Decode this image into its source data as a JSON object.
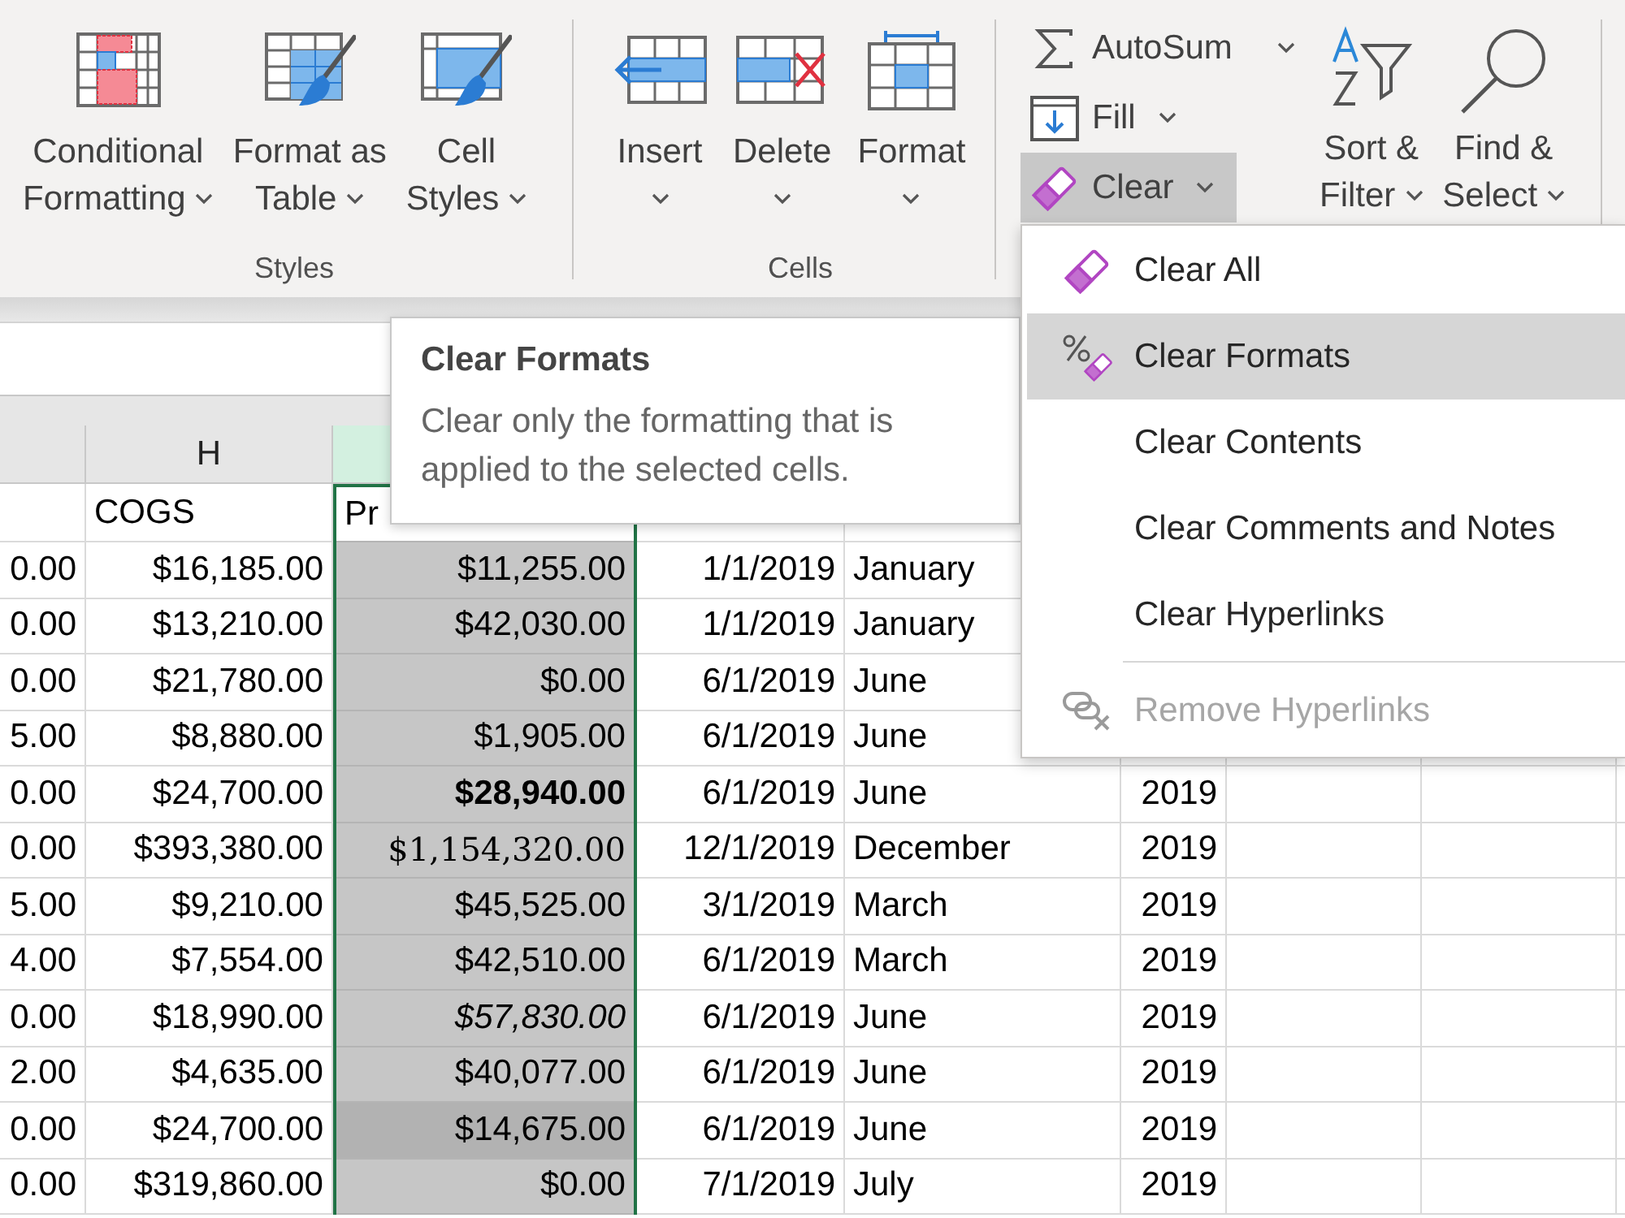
{
  "ribbon": {
    "groups": [
      {
        "label": "Styles",
        "buttons": [
          {
            "kind": "large",
            "lines": [
              "Conditional",
              "Formatting"
            ],
            "dropdown": true,
            "pressed": false
          },
          {
            "kind": "large",
            "lines": [
              "Format as",
              "Table"
            ],
            "dropdown": true,
            "pressed": false
          },
          {
            "kind": "large",
            "lines": [
              "Cell",
              "Styles"
            ],
            "dropdown": true,
            "pressed": false
          }
        ]
      },
      {
        "label": "Cells",
        "buttons": [
          {
            "kind": "large",
            "lines": [
              "Insert"
            ],
            "dropdown": true,
            "pressed": false
          },
          {
            "kind": "large",
            "lines": [
              "Delete"
            ],
            "dropdown": true,
            "pressed": false
          },
          {
            "kind": "large",
            "lines": [
              "Format"
            ],
            "dropdown": true,
            "pressed": false
          }
        ]
      },
      {
        "buttons": [
          {
            "kind": "small",
            "lines": [
              "AutoSum"
            ],
            "dropdown": true,
            "pressed": false
          },
          {
            "kind": "small",
            "lines": [
              "Fill"
            ],
            "dropdown": true,
            "pressed": false
          },
          {
            "kind": "small",
            "lines": [
              "Clear"
            ],
            "dropdown": true,
            "pressed": true
          },
          {
            "kind": "large",
            "lines": [
              "Sort &",
              "Filter"
            ],
            "dropdown": true,
            "pressed": false
          },
          {
            "kind": "large",
            "lines": [
              "Find &",
              "Select"
            ],
            "dropdown": true,
            "pressed": false
          }
        ]
      }
    ]
  },
  "menu": {
    "items": [
      {
        "label": "Clear All",
        "selected": false,
        "disabled": false,
        "divider_before": false
      },
      {
        "label": "Clear Formats",
        "selected": true,
        "disabled": false,
        "divider_before": false
      },
      {
        "label": "Clear Contents",
        "selected": false,
        "disabled": false,
        "divider_before": false
      },
      {
        "label": "Clear Comments and Notes",
        "selected": false,
        "disabled": false,
        "divider_before": false
      },
      {
        "label": "Clear Hyperlinks",
        "selected": false,
        "disabled": false,
        "divider_before": false
      },
      {
        "label": "Remove Hyperlinks",
        "selected": false,
        "disabled": true,
        "divider_before": true
      }
    ]
  },
  "tooltip": {
    "title": "Clear Formats",
    "text": "Clear only the formatting that is applied to the selected cells."
  },
  "sheet": {
    "columns": [
      {
        "selected": false,
        "cells": [
          null,
          "0.00",
          "0.00",
          "0.00",
          "5.00",
          "0.00",
          "0.00",
          "5.00",
          "4.00",
          "0.00",
          "2.00",
          "0.00",
          "0.00"
        ]
      },
      {
        "label": "H",
        "selected": false,
        "cells": [
          "COGS",
          "$16,185.00",
          "$13,210.00",
          "$21,780.00",
          "$8,880.00",
          "$24,700.00",
          "$393,380.00",
          "$9,210.00",
          "$7,554.00",
          "$18,990.00",
          "$4,635.00",
          "$24,700.00",
          "$319,860.00"
        ]
      },
      {
        "selected": true,
        "cells": [
          {
            "text": "Pr",
            "active": true,
            "kind": "plain"
          },
          {
            "text": "$11,255.00",
            "active": false,
            "kind": "plain"
          },
          {
            "text": "$42,030.00",
            "active": false,
            "kind": "plain"
          },
          {
            "text": "$0.00",
            "active": false,
            "kind": "plain"
          },
          {
            "text": "$1,905.00",
            "active": false,
            "kind": "plain"
          },
          {
            "text": "$28,940.00",
            "active": false,
            "kind": "bold"
          },
          {
            "text": "$1,154,320.00",
            "active": false,
            "kind": "serif"
          },
          {
            "text": "$45,525.00",
            "active": false,
            "kind": "plain"
          },
          {
            "text": "$42,510.00",
            "active": false,
            "kind": "plain"
          },
          {
            "text": "$57,830.00",
            "active": false,
            "kind": "italic"
          },
          {
            "text": "$40,077.00",
            "active": false,
            "kind": "plain"
          },
          {
            "text": "$14,675.00",
            "active": false,
            "kind": "shaded"
          },
          {
            "text": "$0.00",
            "active": false,
            "kind": "plain"
          }
        ]
      },
      {
        "selected": false,
        "cells": [
          null,
          "1/1/2019",
          "1/1/2019",
          "6/1/2019",
          "6/1/2019",
          "6/1/2019",
          "12/1/2019",
          "3/1/2019",
          "6/1/2019",
          "6/1/2019",
          "6/1/2019",
          "6/1/2019",
          "7/1/2019"
        ]
      },
      {
        "selected": false,
        "cells": [
          null,
          "January",
          "January",
          "June",
          "June",
          "June",
          "December",
          "March",
          "March",
          "June",
          "June",
          "June",
          "July"
        ]
      },
      {
        "selected": false,
        "cells": [
          null,
          null,
          null,
          null,
          null,
          "2019",
          "2019",
          "2019",
          "2019",
          "2019",
          "2019",
          "2019",
          "2019"
        ]
      },
      {
        "selected": false
      },
      {
        "selected": false
      },
      {
        "selected": false
      }
    ]
  }
}
